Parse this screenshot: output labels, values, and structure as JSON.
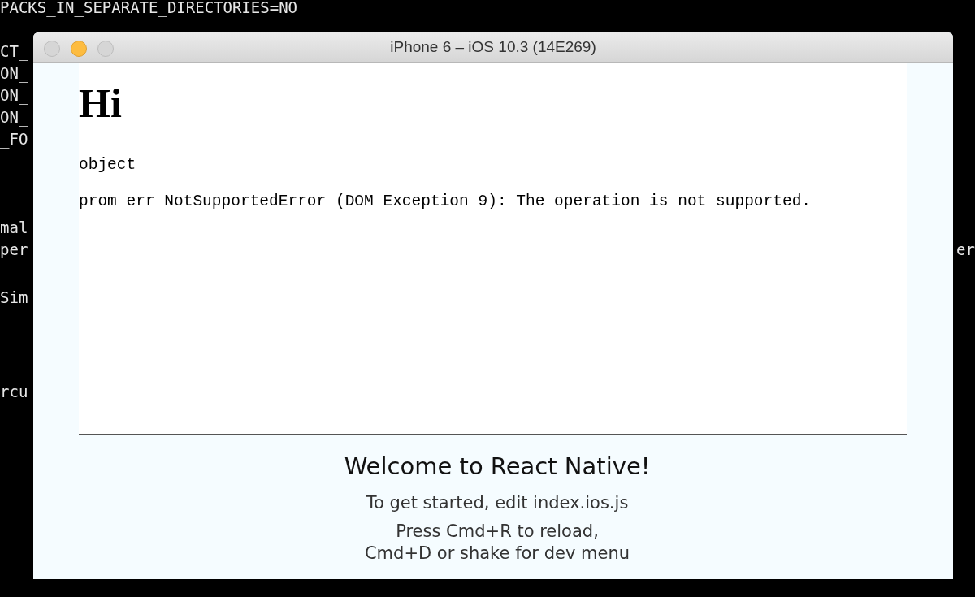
{
  "terminal": {
    "blocks": [
      {
        "lines": [
          {
            "left": "PACKS_IN_SEPARATE_DIRECTORIES=NO"
          },
          {
            "left": "CT_"
          },
          {
            "left": "ON_"
          },
          {
            "left": "ON_"
          },
          {
            "left": "ON_"
          },
          {
            "left": "_FO"
          }
        ]
      },
      {
        "lines": [
          {
            "left": "mal"
          },
          {
            "left": "per",
            "right": "er"
          }
        ]
      },
      {
        "lines": [
          {
            "left": "Sim"
          }
        ]
      },
      {
        "lines": [
          {
            "left": "rcu"
          }
        ]
      }
    ]
  },
  "window": {
    "title": "iPhone 6 – iOS 10.3 (14E269)",
    "buttons": [
      {
        "kind": "close",
        "active": false
      },
      {
        "kind": "minimize",
        "active": true
      },
      {
        "kind": "zoom",
        "active": false
      }
    ]
  },
  "webview": {
    "heading": "Hi",
    "lines": [
      "object",
      "prom err NotSupportedError (DOM Exception 9): The operation is not supported."
    ]
  },
  "app": {
    "welcome": "Welcome to React Native!",
    "instructions": "To get started, edit index.ios.js",
    "shortcuts": [
      "Press Cmd+R to reload,",
      "Cmd+D or shake for dev menu"
    ]
  }
}
